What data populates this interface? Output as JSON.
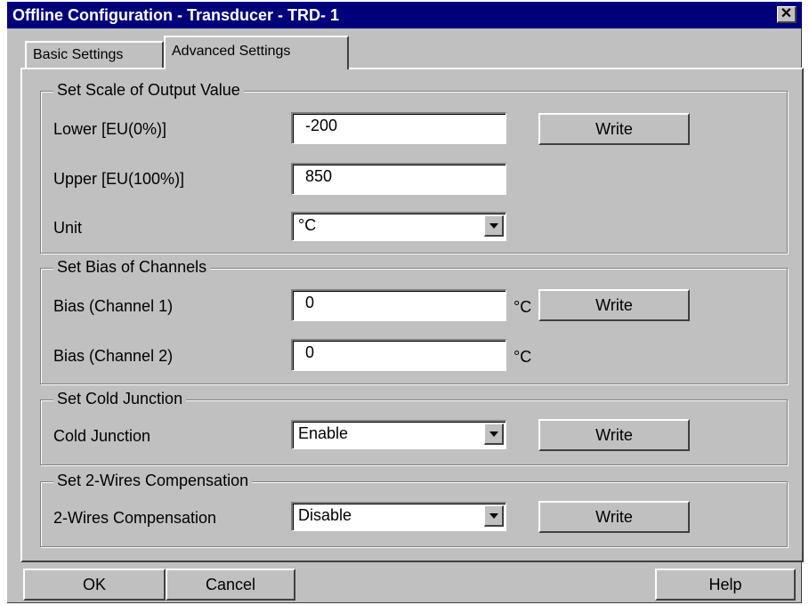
{
  "window": {
    "title": "Offline Configuration - Transducer - TRD- 1",
    "close_glyph": "✕"
  },
  "tabs": [
    {
      "label": "Basic Settings"
    },
    {
      "label": "Advanced Settings"
    }
  ],
  "scale_group": {
    "legend": "Set Scale of Output Value",
    "lower_label": "Lower [EU(0%)]",
    "lower_value": "-200",
    "upper_label": "Upper [EU(100%)]",
    "upper_value": "850",
    "unit_label": "Unit",
    "unit_value": "°C",
    "write_label": "Write"
  },
  "bias_group": {
    "legend": "Set Bias of Channels",
    "ch1_label": "Bias (Channel 1)",
    "ch1_value": "0",
    "ch1_unit": "°C",
    "ch2_label": "Bias (Channel 2)",
    "ch2_value": "0",
    "ch2_unit": "°C",
    "write_label": "Write"
  },
  "cold_group": {
    "legend": "Set Cold Junction",
    "label": "Cold Junction",
    "value": "Enable",
    "write_label": "Write"
  },
  "wires_group": {
    "legend": "Set 2-Wires Compensation",
    "label": "2-Wires Compensation",
    "value": "Disable",
    "write_label": "Write"
  },
  "footer": {
    "ok": "OK",
    "cancel": "Cancel",
    "help": "Help"
  }
}
